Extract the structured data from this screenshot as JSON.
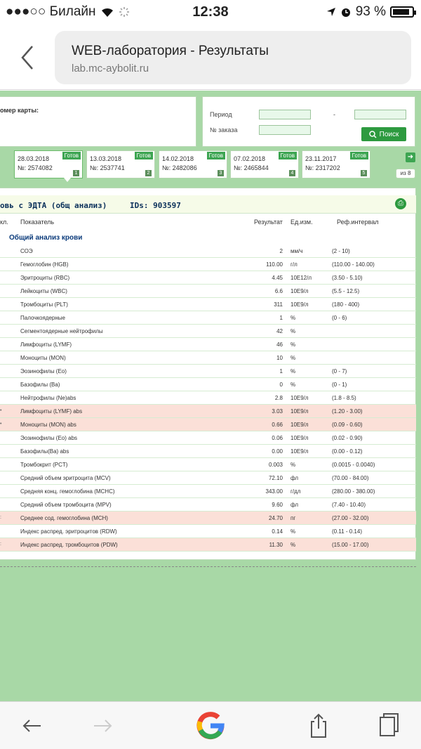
{
  "status_bar": {
    "carrier": "●●●○○ Билайн",
    "time": "12:38",
    "battery": "93 %"
  },
  "browser": {
    "page_title": "WEB-лаборатория - Результаты",
    "url": "lab.mc-aybolit.ru"
  },
  "form": {
    "card_label": "омер карты:",
    "period_label": "Период",
    "period_dash": "-",
    "order_label": "№ заказа",
    "search_label": "Поиск"
  },
  "orders": [
    {
      "date": "28.03.2018",
      "number": "№: 2574082",
      "status": "Готов",
      "index": "1"
    },
    {
      "date": "13.03.2018",
      "number": "№: 2537741",
      "status": "Готов",
      "index": "2"
    },
    {
      "date": "14.02.2018",
      "number": "№: 2482086",
      "status": "Готов",
      "index": "3"
    },
    {
      "date": "07.02.2018",
      "number": "№: 2465844",
      "status": "Готов",
      "index": "4"
    },
    {
      "date": "23.11.2017",
      "number": "№: 2317202",
      "status": "Готов",
      "index": "5"
    }
  ],
  "pages_label": "из 8",
  "result": {
    "title": "овь с ЭДТА (общ анализ)",
    "ids": "IDs: 903597",
    "columns": {
      "col0": "кл.",
      "indicator": "Показатель",
      "result": "Результат",
      "unit": "Ед.изм.",
      "ref": "Реф.интервал"
    },
    "section": "Общий анализ крови",
    "rows": [
      {
        "mark": "",
        "name": "СОЭ",
        "value": "2",
        "unit": "мм/ч",
        "ref": "(2 - 10)",
        "abnormal": false
      },
      {
        "mark": "",
        "name": "Гемоглобин (HGB)",
        "value": "110.00",
        "unit": "г/л",
        "ref": "(110.00 - 140.00)",
        "abnormal": false
      },
      {
        "mark": "",
        "name": "Эритроциты (RBC)",
        "value": "4.45",
        "unit": "10E12/л",
        "ref": "(3.50 - 5.10)",
        "abnormal": false
      },
      {
        "mark": "",
        "name": "Лейкоциты (WBC)",
        "value": "6.6",
        "unit": "10E9/л",
        "ref": "(5.5 - 12.5)",
        "abnormal": false
      },
      {
        "mark": "",
        "name": "Тромбоциты (PLT)",
        "value": "311",
        "unit": "10E9/л",
        "ref": "(180 - 400)",
        "abnormal": false
      },
      {
        "mark": "",
        "name": "Палочкоядерные",
        "value": "1",
        "unit": "%",
        "ref": "(0 - 6)",
        "abnormal": false
      },
      {
        "mark": "",
        "name": "Сегментоядерные нейтрофилы",
        "value": "42",
        "unit": "%",
        "ref": "",
        "abnormal": false
      },
      {
        "mark": "",
        "name": "Лимфоциты (LYMF)",
        "value": "46",
        "unit": "%",
        "ref": "",
        "abnormal": false
      },
      {
        "mark": "",
        "name": "Моноциты (MON)",
        "value": "10",
        "unit": "%",
        "ref": "",
        "abnormal": false
      },
      {
        "mark": "",
        "name": "Эозинофилы (Eo)",
        "value": "1",
        "unit": "%",
        "ref": "(0 - 7)",
        "abnormal": false
      },
      {
        "mark": "",
        "name": "Базофилы (Ba)",
        "value": "0",
        "unit": "%",
        "ref": "(0 - 1)",
        "abnormal": false
      },
      {
        "mark": "",
        "name": "Нейтрофилы (Ne)abs",
        "value": "2.8",
        "unit": "10E9/л",
        "ref": "(1.8 - 8.5)",
        "abnormal": false
      },
      {
        "mark": "•",
        "name": "Лимфоциты (LYMF) abs",
        "value": "3.03",
        "unit": "10E9/л",
        "ref": "(1.20 - 3.00)",
        "abnormal": true
      },
      {
        "mark": "•",
        "name": "Моноциты (MON) abs",
        "value": "0.66",
        "unit": "10E9/л",
        "ref": "(0.09 - 0.60)",
        "abnormal": true
      },
      {
        "mark": "",
        "name": "Эозинофилы (Eo) abs",
        "value": "0.06",
        "unit": "10E9/л",
        "ref": "(0.02 - 0.90)",
        "abnormal": false
      },
      {
        "mark": "",
        "name": "Базофилы(Ba) abs",
        "value": "0.00",
        "unit": "10E9/л",
        "ref": "(0.00 - 0.12)",
        "abnormal": false
      },
      {
        "mark": "",
        "name": "Тромбокрит (PCT)",
        "value": "0.003",
        "unit": "%",
        "ref": "(0.0015 - 0.0040)",
        "abnormal": false
      },
      {
        "mark": "",
        "name": "Средний объем эритроцита (MCV)",
        "value": "72.10",
        "unit": "фл",
        "ref": "(70.00 - 84.00)",
        "abnormal": false
      },
      {
        "mark": "",
        "name": "Средняя конц. гемоглобина (MCHC)",
        "value": "343.00",
        "unit": "г/дл",
        "ref": "(280.00 - 380.00)",
        "abnormal": false
      },
      {
        "mark": "",
        "name": "Средний объем тромбоцита (MPV)",
        "value": "9.60",
        "unit": "фл",
        "ref": "(7.40 - 10.40)",
        "abnormal": false
      },
      {
        "mark": ":",
        "name": "Среднее сод. гемоглобина (MCH)",
        "value": "24.70",
        "unit": "пг",
        "ref": "(27.00 - 32.00)",
        "abnormal": true
      },
      {
        "mark": "",
        "name": "Индекс распред. эритроцитов (RDW)",
        "value": "0.14",
        "unit": "%",
        "ref": "(0.11 - 0.14)",
        "abnormal": false
      },
      {
        "mark": ":",
        "name": "Индекс распред. тромбоцитов (PDW)",
        "value": "11.30",
        "unit": "%",
        "ref": "(15.00 - 17.00)",
        "abnormal": true
      }
    ]
  },
  "icons": {
    "back": "chevron-left-icon",
    "search": "search-icon",
    "print": "print-icon",
    "next": "arrow-right-icon",
    "google": "google-logo",
    "share": "share-icon",
    "tabs": "tabs-icon"
  },
  "colors": {
    "page_bg": "#a8d8a6",
    "accent_green": "#2d9a3f",
    "abnormal_row": "#fbe0d8",
    "heading_blue": "#0a2f5a"
  }
}
